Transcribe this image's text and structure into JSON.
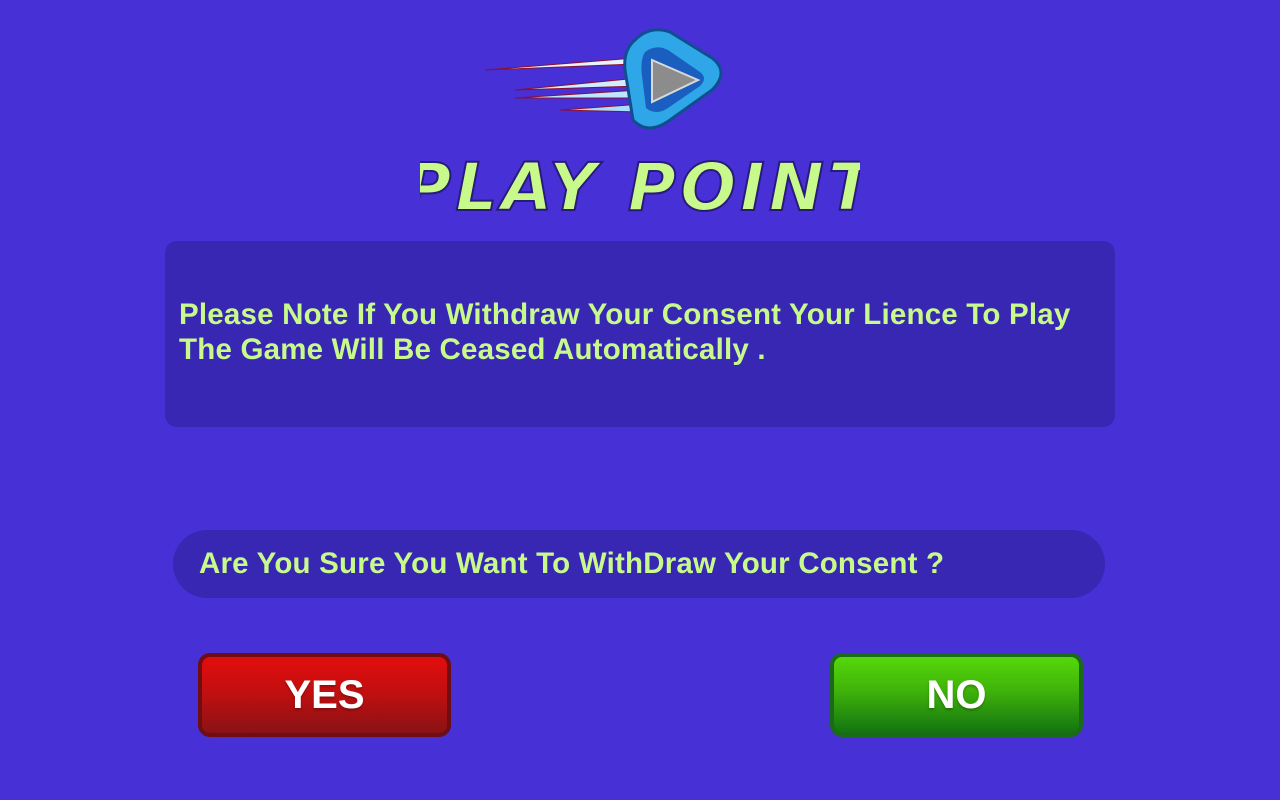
{
  "brand": {
    "logo_text": "PLAY POINT",
    "icon": "play-button-icon",
    "colors": {
      "logo_text": "#c7f98b",
      "logo_ring": "#2ea6e8",
      "logo_play": "#8a8a8a"
    }
  },
  "dialog": {
    "notice": "Please Note If You Withdraw Your Consent Your Lience To Play The Game Will Be Ceased Automatically .",
    "question": "Are You Sure You Want To WithDraw Your Consent ?"
  },
  "buttons": {
    "yes_label": "YES",
    "no_label": "NO"
  },
  "colors": {
    "background": "#4630d6",
    "panel": "#3827b2",
    "text": "#c7f98b",
    "yes": "#d10e0e",
    "no": "#44c00a"
  }
}
